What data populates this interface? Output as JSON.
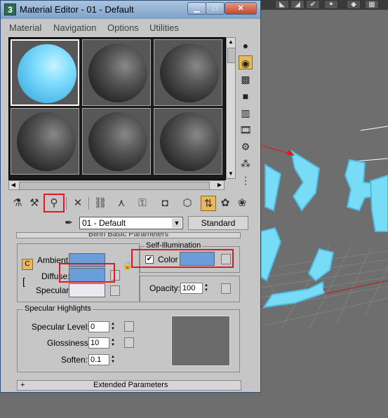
{
  "window": {
    "title": "Material Editor - 01 - Default",
    "icon": "3ds-max-icon"
  },
  "menu": [
    "Material",
    "Navigation",
    "Options",
    "Utilities"
  ],
  "material": {
    "name": "01 - Default",
    "type_button": "Standard"
  },
  "rollout": {
    "title": "Blinn Basic Parameters"
  },
  "basic": {
    "ambient_label": "Ambient:",
    "diffuse_label": "Diffuse:",
    "specular_label": "Specular:",
    "ambient_color": "#6a9edb",
    "diffuse_color": "#6a9edb",
    "specular_color": "#ece8ef"
  },
  "self_illum": {
    "group_label": "Self-Illumination",
    "color_label": "Color",
    "checked": true,
    "color": "#6a9edb"
  },
  "opacity": {
    "label": "Opacity:",
    "value": "100"
  },
  "highlights": {
    "group_label": "Specular Highlights",
    "level_label": "Specular Level:",
    "level_value": "0",
    "gloss_label": "Glossiness:",
    "gloss_value": "10",
    "soften_label": "Soften:",
    "soften_value": "0.1"
  },
  "extended": {
    "sign": "+",
    "title": "Extended Parameters"
  }
}
